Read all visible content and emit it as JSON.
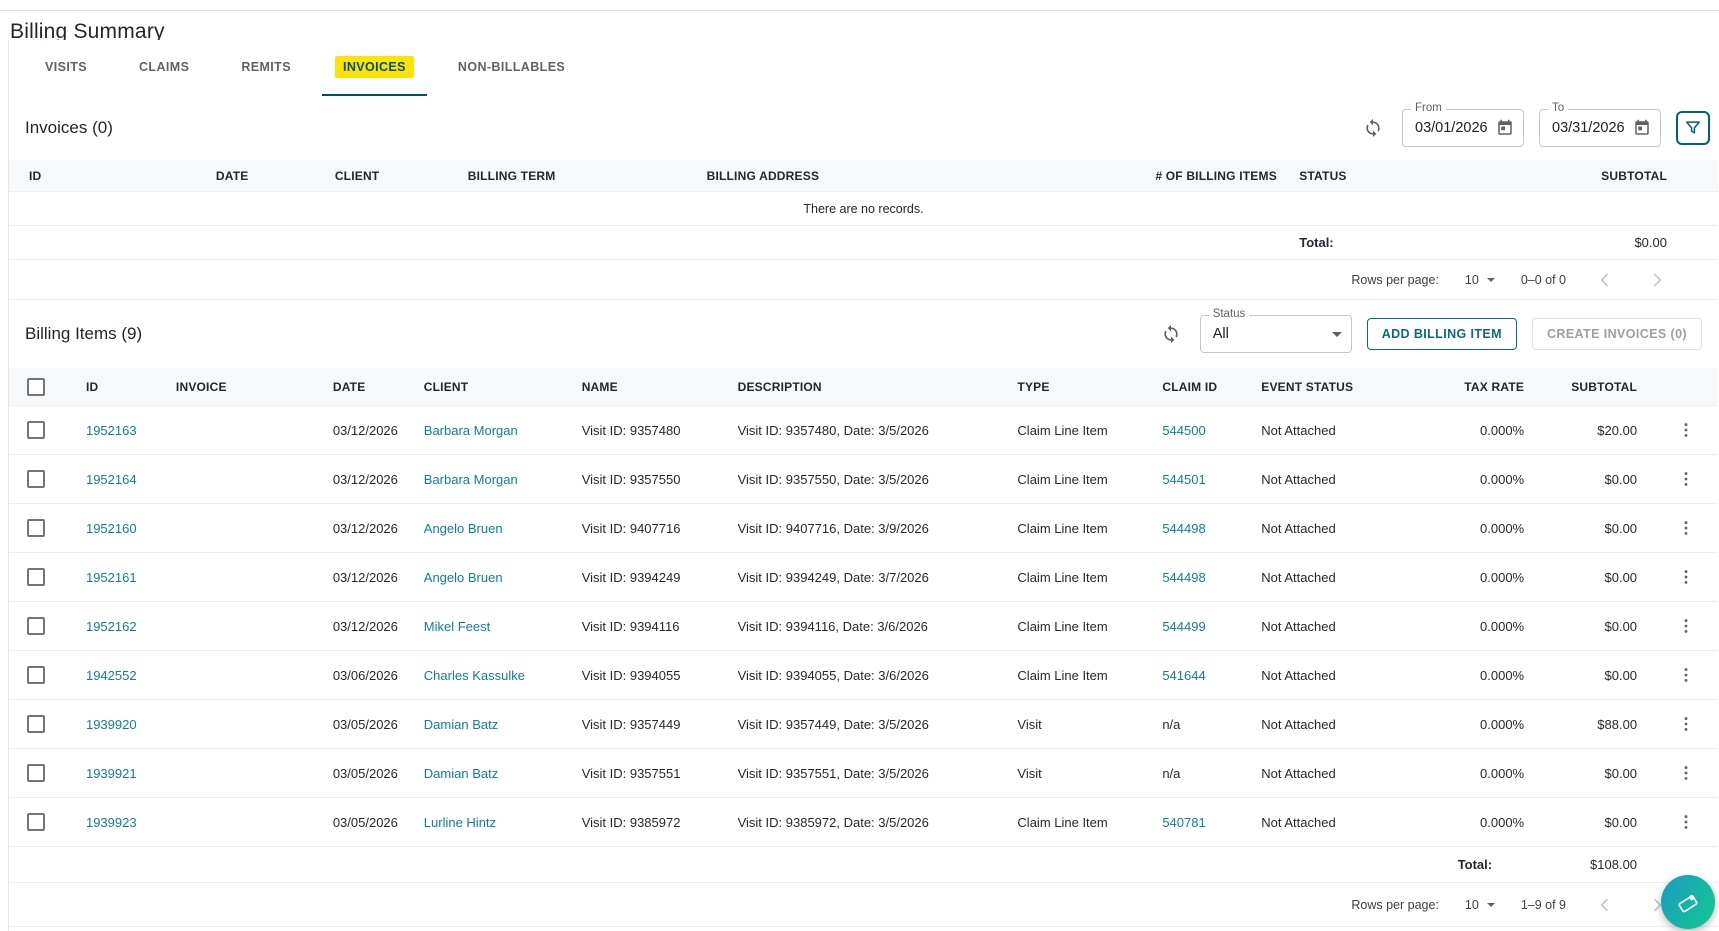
{
  "page": {
    "title": "Billing Summary"
  },
  "tabs": [
    {
      "label": "VISITS",
      "active": false
    },
    {
      "label": "CLAIMS",
      "active": false
    },
    {
      "label": "REMITS",
      "active": false
    },
    {
      "label": "INVOICES",
      "active": true
    },
    {
      "label": "NON-BILLABLES",
      "active": false
    }
  ],
  "invoices": {
    "heading": "Invoices (0)",
    "filters": {
      "from_label": "From",
      "from_value": "03/01/2026",
      "to_label": "To",
      "to_value": "03/31/2026"
    },
    "columns": [
      "ID",
      "DATE",
      "CLIENT",
      "BILLING TERM",
      "BILLING ADDRESS",
      "# OF BILLING ITEMS",
      "STATUS",
      "SUBTOTAL"
    ],
    "empty_message": "There are no records.",
    "total_label": "Total:",
    "total_value": "$0.00",
    "pagination": {
      "rows_per_page_label": "Rows per page:",
      "rows_per_page": "10",
      "range": "0–0 of 0"
    }
  },
  "billing_items": {
    "heading": "Billing Items (9)",
    "status_filter": {
      "label": "Status",
      "value": "All"
    },
    "add_button_label": "ADD BILLING ITEM",
    "create_button_label": "CREATE INVOICES (0)",
    "columns": [
      "ID",
      "INVOICE",
      "DATE",
      "CLIENT",
      "NAME",
      "DESCRIPTION",
      "TYPE",
      "CLAIM ID",
      "EVENT STATUS",
      "TAX RATE",
      "SUBTOTAL"
    ],
    "rows": [
      {
        "id": "1952163",
        "invoice": "",
        "date": "03/12/2026",
        "client": "Barbara Morgan",
        "name": "Visit ID: 9357480",
        "description": "Visit ID: 9357480, Date: 3/5/2026",
        "type": "Claim Line Item",
        "claim_id": "544500",
        "event_status": "Not Attached",
        "tax_rate": "0.000%",
        "subtotal": "$20.00"
      },
      {
        "id": "1952164",
        "invoice": "",
        "date": "03/12/2026",
        "client": "Barbara Morgan",
        "name": "Visit ID: 9357550",
        "description": "Visit ID: 9357550, Date: 3/5/2026",
        "type": "Claim Line Item",
        "claim_id": "544501",
        "event_status": "Not Attached",
        "tax_rate": "0.000%",
        "subtotal": "$0.00"
      },
      {
        "id": "1952160",
        "invoice": "",
        "date": "03/12/2026",
        "client": "Angelo Bruen",
        "name": "Visit ID: 9407716",
        "description": "Visit ID: 9407716, Date: 3/9/2026",
        "type": "Claim Line Item",
        "claim_id": "544498",
        "event_status": "Not Attached",
        "tax_rate": "0.000%",
        "subtotal": "$0.00"
      },
      {
        "id": "1952161",
        "invoice": "",
        "date": "03/12/2026",
        "client": "Angelo Bruen",
        "name": "Visit ID: 9394249",
        "description": "Visit ID: 9394249, Date: 3/7/2026",
        "type": "Claim Line Item",
        "claim_id": "544498",
        "event_status": "Not Attached",
        "tax_rate": "0.000%",
        "subtotal": "$0.00"
      },
      {
        "id": "1952162",
        "invoice": "",
        "date": "03/12/2026",
        "client": "Mikel Feest",
        "name": "Visit ID: 9394116",
        "description": "Visit ID: 9394116, Date: 3/6/2026",
        "type": "Claim Line Item",
        "claim_id": "544499",
        "event_status": "Not Attached",
        "tax_rate": "0.000%",
        "subtotal": "$0.00"
      },
      {
        "id": "1942552",
        "invoice": "",
        "date": "03/06/2026",
        "client": "Charles Kassulke",
        "name": "Visit ID: 9394055",
        "description": "Visit ID: 9394055, Date: 3/6/2026",
        "type": "Claim Line Item",
        "claim_id": "541644",
        "event_status": "Not Attached",
        "tax_rate": "0.000%",
        "subtotal": "$0.00"
      },
      {
        "id": "1939920",
        "invoice": "",
        "date": "03/05/2026",
        "client": "Damian Batz",
        "name": "Visit ID: 9357449",
        "description": "Visit ID: 9357449, Date: 3/5/2026",
        "type": "Visit",
        "claim_id": "n/a",
        "event_status": "Not Attached",
        "tax_rate": "0.000%",
        "subtotal": "$88.00"
      },
      {
        "id": "1939921",
        "invoice": "",
        "date": "03/05/2026",
        "client": "Damian Batz",
        "name": "Visit ID: 9357551",
        "description": "Visit ID: 9357551, Date: 3/5/2026",
        "type": "Visit",
        "claim_id": "n/a",
        "event_status": "Not Attached",
        "tax_rate": "0.000%",
        "subtotal": "$0.00"
      },
      {
        "id": "1939923",
        "invoice": "",
        "date": "03/05/2026",
        "client": "Lurline Hintz",
        "name": "Visit ID: 9385972",
        "description": "Visit ID: 9385972, Date: 3/5/2026",
        "type": "Claim Line Item",
        "claim_id": "540781",
        "event_status": "Not Attached",
        "tax_rate": "0.000%",
        "subtotal": "$0.00"
      }
    ],
    "total_label": "Total:",
    "total_value": "$108.00",
    "pagination": {
      "rows_per_page_label": "Rows per page:",
      "rows_per_page": "10",
      "range": "1–9 of 9"
    }
  },
  "icons": {
    "refresh": "refresh-icon",
    "calendar": "calendar-icon",
    "filter": "filter-funnel-icon",
    "kebab": "kebab-menu-icon",
    "chevron_left": "chevron-left-icon",
    "chevron_right": "chevron-right-icon",
    "dropdown": "dropdown-caret-icon",
    "fab": "ticket-heart-icon"
  },
  "colors": {
    "active_tab_bg": "#fce303",
    "active_tab_text": "#00525c",
    "link_teal": "#12808c",
    "button_teal": "#0d6b75",
    "fab_gradient_start": "#1d9ac2",
    "fab_gradient_end": "#0fca90",
    "header_row_bg": "#f7f8fa"
  }
}
